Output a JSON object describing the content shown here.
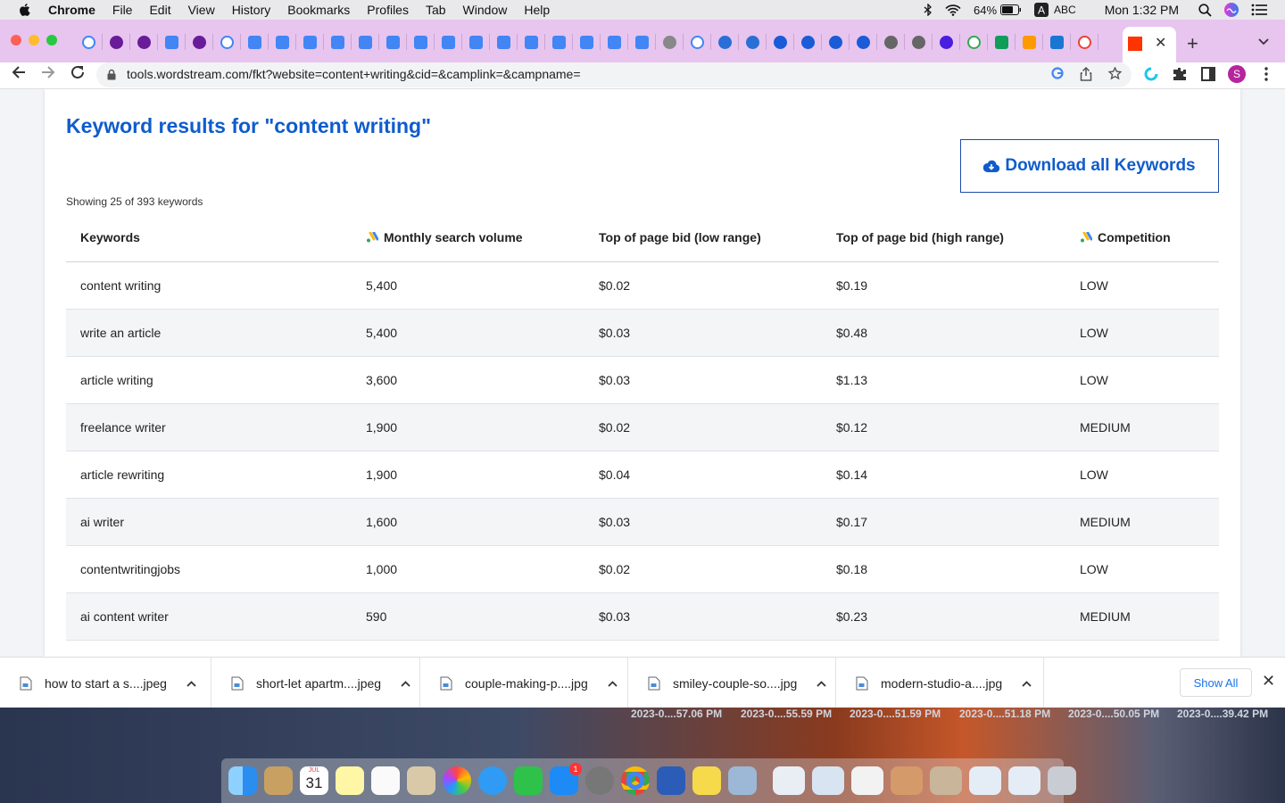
{
  "menubar": {
    "app": "Chrome",
    "menus": [
      "File",
      "Edit",
      "View",
      "History",
      "Bookmarks",
      "Profiles",
      "Tab",
      "Window",
      "Help"
    ],
    "battery": "64%",
    "input_source": "ABC",
    "clock": "Mon 1:32 PM"
  },
  "toolbar": {
    "url": "tools.wordstream.com/fkt?website=content+writing&cid=&camplink=&campname=",
    "profile_initial": "S"
  },
  "page": {
    "title": "Keyword results for \"content writing\"",
    "download_button": "Download all Keywords",
    "showing": "Showing 25 of 393 keywords",
    "columns": [
      "Keywords",
      "Monthly search volume",
      "Top of page bid (low range)",
      "Top of page bid (high range)",
      "Competition"
    ],
    "rows": [
      [
        "content writing",
        "5,400",
        "$0.02",
        "$0.19",
        "LOW"
      ],
      [
        "write an article",
        "5,400",
        "$0.03",
        "$0.48",
        "LOW"
      ],
      [
        "article writing",
        "3,600",
        "$0.03",
        "$1.13",
        "LOW"
      ],
      [
        "freelance writer",
        "1,900",
        "$0.02",
        "$0.12",
        "MEDIUM"
      ],
      [
        "article rewriting",
        "1,900",
        "$0.04",
        "$0.14",
        "LOW"
      ],
      [
        "ai writer",
        "1,600",
        "$0.03",
        "$0.17",
        "MEDIUM"
      ],
      [
        "contentwritingjobs",
        "1,000",
        "$0.02",
        "$0.18",
        "LOW"
      ],
      [
        "ai content writer",
        "590",
        "$0.03",
        "$0.23",
        "MEDIUM"
      ]
    ]
  },
  "downloads": {
    "items": [
      "how to start a s....jpeg",
      "short-let apartm....jpeg",
      "couple-making-p....jpg",
      "smiley-couple-so....jpg",
      "modern-studio-a....jpg"
    ],
    "show_all": "Show All"
  },
  "desktop": {
    "stamps": [
      "2023-0....57.06 PM",
      "2023-0....55.59 PM",
      "2023-0....51.59 PM",
      "2023-0....51.18 PM",
      "2023-0....50.05 PM",
      "2023-0....39.42 PM"
    ],
    "calendar_month": "JUL",
    "calendar_day": "31",
    "appstore_badge": "1"
  },
  "colors": {
    "brand_blue": "#0f5ccc",
    "tabstrip": "#e7c5ef"
  }
}
